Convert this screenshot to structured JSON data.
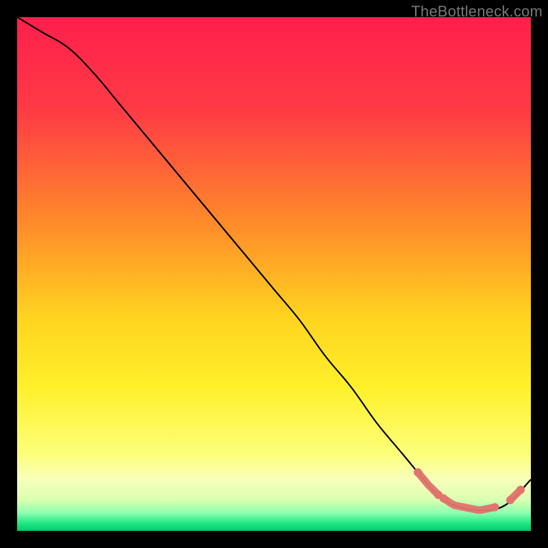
{
  "watermark": "TheBottleneck.com",
  "chart_data": {
    "type": "line",
    "title": "",
    "xlabel": "",
    "ylabel": "",
    "xlim": [
      0,
      100
    ],
    "ylim": [
      0,
      100
    ],
    "grid": false,
    "series": [
      {
        "name": "curve",
        "x": [
          0,
          5,
          10,
          15,
          20,
          25,
          30,
          35,
          40,
          45,
          50,
          55,
          60,
          65,
          70,
          75,
          80,
          82,
          85,
          90,
          95,
          100
        ],
        "y": [
          100,
          97,
          94,
          89,
          83,
          77,
          71,
          65,
          59,
          53,
          47,
          41,
          34,
          28,
          21,
          15,
          9,
          7,
          5,
          4,
          5,
          10
        ],
        "color": "#000000"
      }
    ],
    "highlight_segments": [
      {
        "x_start": 78,
        "x_end": 82,
        "color": "#e2736d"
      },
      {
        "x_start": 83,
        "x_end": 93,
        "color": "#e2736d"
      },
      {
        "x_start": 96,
        "x_end": 98,
        "color": "#e2736d"
      }
    ],
    "gradient_stops": [
      {
        "offset": 0.0,
        "color": "#ff1f4b"
      },
      {
        "offset": 0.18,
        "color": "#ff3a45"
      },
      {
        "offset": 0.4,
        "color": "#ff8a2a"
      },
      {
        "offset": 0.58,
        "color": "#ffd21f"
      },
      {
        "offset": 0.72,
        "color": "#fff02a"
      },
      {
        "offset": 0.85,
        "color": "#fcff7a"
      },
      {
        "offset": 0.9,
        "color": "#f8ffba"
      },
      {
        "offset": 0.94,
        "color": "#d9ffb0"
      },
      {
        "offset": 0.965,
        "color": "#8dffb0"
      },
      {
        "offset": 0.985,
        "color": "#20e884"
      },
      {
        "offset": 1.0,
        "color": "#05c96d"
      }
    ]
  }
}
